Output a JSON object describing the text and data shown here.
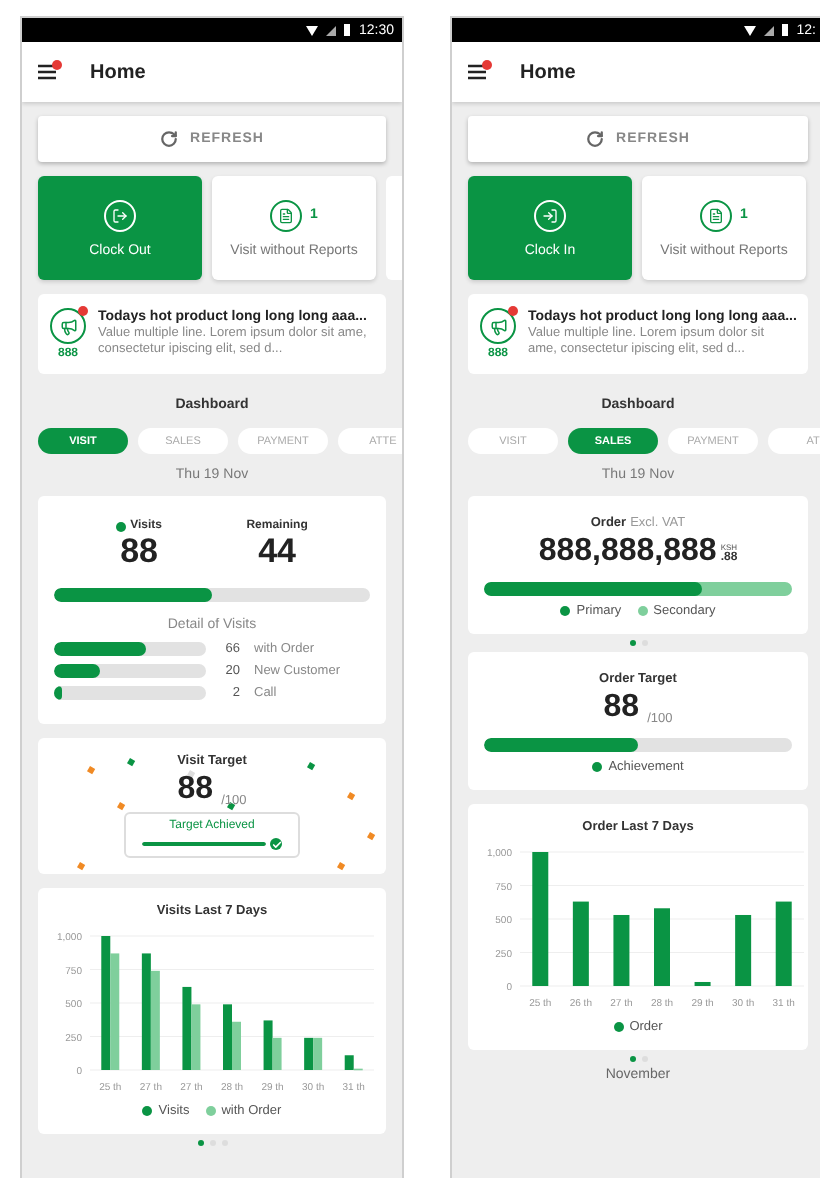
{
  "phones": [
    {
      "status_time": "12:30",
      "title": "Home",
      "menu_badge": true,
      "refresh": "REFRESH",
      "actions": [
        {
          "kind": "clock_out",
          "label": "Clock Out"
        },
        {
          "kind": "count",
          "count": "1",
          "label": "Visit without Reports"
        },
        {
          "kind": "clipped"
        }
      ],
      "notice": {
        "title": "Todays hot product long long long aaa...",
        "body": "Value multiple line. Lorem ipsum dolor sit ame, consectetur ipiscing elit, sed d...",
        "count": "888",
        "unread": true
      },
      "section": "Dashboard",
      "tabs": [
        {
          "label": "VISIT",
          "selected": true
        },
        {
          "label": "SALES",
          "selected": false
        },
        {
          "label": "PAYMENT",
          "selected": false
        },
        {
          "label": "ATTE",
          "selected": false
        }
      ],
      "date": "Thu 19 Nov",
      "cards": [
        {
          "kind": "visits",
          "visits_label": "Visits",
          "visits": "88",
          "remaining_label": "Remaining",
          "remaining": "44",
          "level": 0.5,
          "detail_title": "Detail of Visits",
          "details": [
            {
              "value": "66",
              "label": "with Order",
              "level": 0.61
            },
            {
              "value": "20",
              "label": "New Customer",
              "level": 0.3
            },
            {
              "value": "2",
              "label": "Call",
              "level": 0.05
            }
          ]
        },
        {
          "kind": "target",
          "title": "Visit Target",
          "value": "88",
          "total": "/100",
          "badge": "Target Achieved",
          "level": 1,
          "achieved": true
        },
        {
          "kind": "chart",
          "chart_data": {
            "type": "bar",
            "title": "Visits Last 7 Days",
            "categories": [
              "25 th",
              "27 th",
              "27 th",
              "28 th",
              "29 th",
              "30 th",
              "31 th"
            ],
            "series": [
              {
                "name": "Visits",
                "color": "#0a9444",
                "values": [
                  1000,
                  870,
                  620,
                  490,
                  370,
                  240,
                  110
                ]
              },
              {
                "name": "with Order",
                "color": "#7fcf9c",
                "values": [
                  870,
                  740,
                  490,
                  360,
                  240,
                  240,
                  10
                ]
              }
            ],
            "ylim": [
              0,
              1000
            ],
            "yticks": [
              {
                "value": 0,
                "label": "0"
              },
              {
                "value": 250,
                "label": "250"
              },
              {
                "value": 500,
                "label": "500"
              },
              {
                "value": 750,
                "label": "750"
              },
              {
                "value": 1000,
                "label": "1,000"
              }
            ],
            "grid": true,
            "legend": "bottom"
          }
        },
        {
          "kind": "pager",
          "dots": [
            {
              "selected": true
            },
            {
              "selected": false
            },
            {
              "selected": false
            }
          ]
        }
      ]
    },
    {
      "status_time": "12:",
      "title": "Home",
      "menu_badge": true,
      "refresh": "REFRESH",
      "actions": [
        {
          "kind": "clock_in",
          "label": "Clock In"
        },
        {
          "kind": "count",
          "count": "1",
          "label": "Visit without Reports"
        }
      ],
      "notice": {
        "title": "Todays hot product long long long aaa...",
        "body": "Value multiple line. Lorem ipsum dolor sit ame, consectetur ipiscing elit, sed d...",
        "count": "888",
        "unread": true
      },
      "section": "Dashboard",
      "tabs": [
        {
          "label": "VISIT",
          "selected": false
        },
        {
          "label": "SALES",
          "selected": true
        },
        {
          "label": "PAYMENT",
          "selected": false
        },
        {
          "label": "AT",
          "selected": false
        }
      ],
      "date": "Thu 19 Nov",
      "cards": [
        {
          "kind": "order",
          "title": "Order",
          "note": "Excl. VAT",
          "value": "888,888,888",
          "currency": "KSH",
          "cents": ".88",
          "level": 0.71,
          "legend": [
            {
              "label": "Primary",
              "color": "#0a9444"
            },
            {
              "label": "Secondary",
              "color": "#7fcf9c"
            }
          ]
        },
        {
          "kind": "pager",
          "dots": [
            {
              "selected": true
            },
            {
              "selected": false
            }
          ]
        },
        {
          "kind": "progress",
          "title": "Order Target",
          "value": "88",
          "total": "/100",
          "level": 0.5,
          "legend": "Achievement"
        },
        {
          "kind": "chart",
          "chart_data": {
            "type": "bar",
            "title": "Order Last 7 Days",
            "categories": [
              "25 th",
              "26 th",
              "27 th",
              "28 th",
              "29 th",
              "30 th",
              "31 th"
            ],
            "series": [
              {
                "name": "Order",
                "color": "#0a9444",
                "values": [
                  1000,
                  630,
                  530,
                  580,
                  30,
                  530,
                  630
                ]
              }
            ],
            "ylim": [
              0,
              1000
            ],
            "yticks": [
              {
                "value": 0,
                "label": "0"
              },
              {
                "value": 250,
                "label": "250"
              },
              {
                "value": 500,
                "label": "500"
              },
              {
                "value": 750,
                "label": "750"
              },
              {
                "value": 1000,
                "label": "1,000"
              }
            ],
            "grid": true,
            "legend": "bottom"
          }
        },
        {
          "kind": "pager",
          "dots": [
            {
              "selected": true
            },
            {
              "selected": false
            }
          ]
        },
        {
          "kind": "heading",
          "text": "November"
        }
      ]
    }
  ]
}
